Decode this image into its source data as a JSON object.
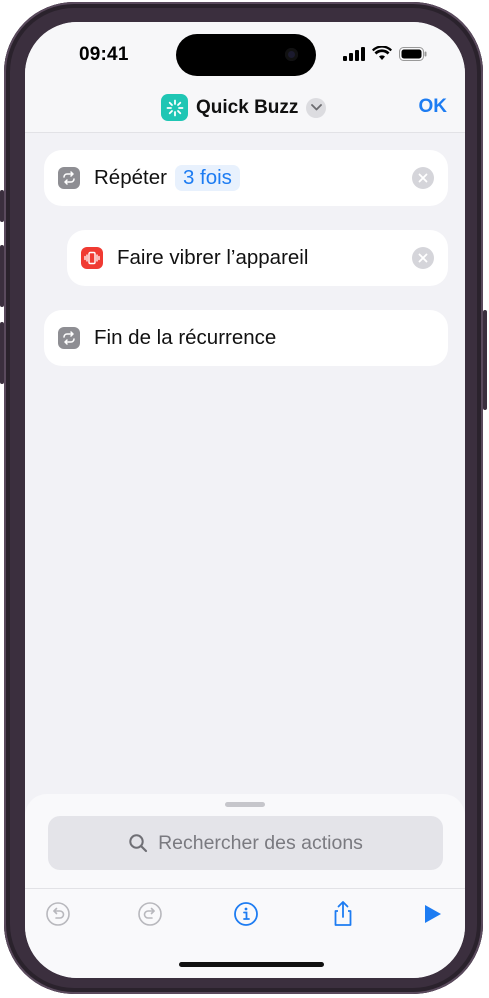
{
  "status_bar": {
    "time": "09:41"
  },
  "nav": {
    "title": "Quick Buzz",
    "ok_label": "OK",
    "app_icon": "sparkle-icon"
  },
  "actions": [
    {
      "label": "Répéter",
      "token": "3 fois",
      "icon": "repeat-icon"
    },
    {
      "label": "Faire vibrer l’appareil",
      "icon": "vibrate-icon"
    },
    {
      "label": "Fin de la récurrence",
      "icon": "repeat-icon"
    }
  ],
  "search": {
    "placeholder": "Rechercher des actions"
  },
  "toolbar": {
    "items": [
      "undo-icon",
      "redo-icon",
      "info-icon",
      "share-icon",
      "play-icon"
    ]
  },
  "colors": {
    "accent": "#1d7cf2",
    "app_icon": "#1fc6b4",
    "vibrate": "#f03a32",
    "repeat": "#8e8e93"
  }
}
